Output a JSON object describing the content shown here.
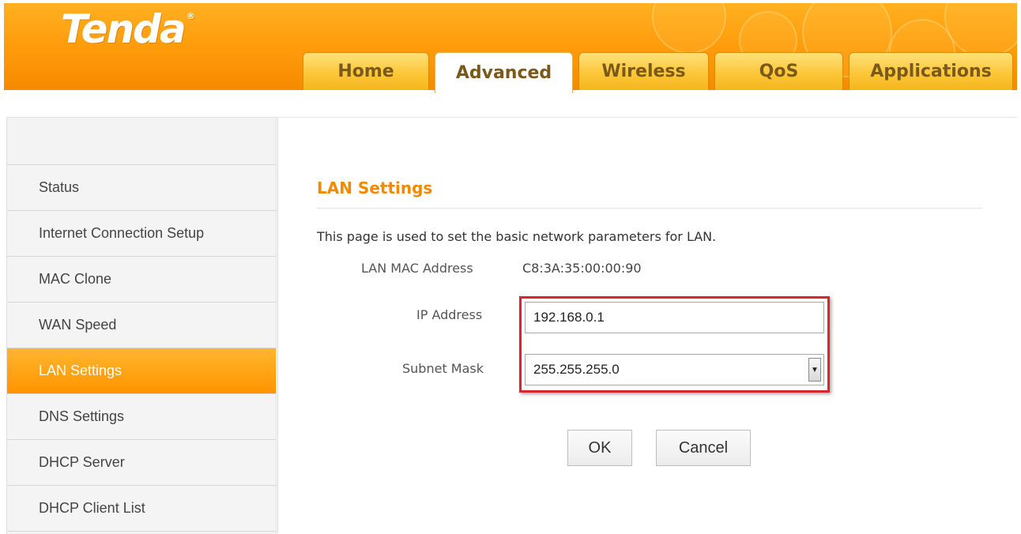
{
  "brand": {
    "logo_text": "Tenda",
    "registered_mark": "®"
  },
  "nav": {
    "tabs": [
      {
        "label": "Home",
        "active": false
      },
      {
        "label": "Advanced",
        "active": true
      },
      {
        "label": "Wireless",
        "active": false
      },
      {
        "label": "QoS",
        "active": false
      },
      {
        "label": "Applications",
        "active": false
      }
    ]
  },
  "sidebar": {
    "items": [
      {
        "label": "Status",
        "active": false
      },
      {
        "label": "Internet Connection Setup",
        "active": false
      },
      {
        "label": "MAC Clone",
        "active": false
      },
      {
        "label": "WAN Speed",
        "active": false
      },
      {
        "label": "LAN Settings",
        "active": true
      },
      {
        "label": "DNS Settings",
        "active": false
      },
      {
        "label": "DHCP Server",
        "active": false
      },
      {
        "label": "DHCP Client List",
        "active": false
      }
    ]
  },
  "main": {
    "title": "LAN Settings",
    "description": "This page is used to set the basic network parameters for LAN.",
    "mac": {
      "label": "LAN MAC Address",
      "value": "C8:3A:35:00:00:90"
    },
    "ip": {
      "label": "IP Address",
      "value": "192.168.0.1"
    },
    "subnet": {
      "label": "Subnet Mask",
      "value": "255.255.255.0"
    },
    "buttons": {
      "ok": "OK",
      "cancel": "Cancel"
    }
  },
  "colors": {
    "header_orange": "#ff9a0a",
    "title_orange": "#f08a00",
    "highlight_red": "#d8262c",
    "active_item": "#ff9400"
  }
}
